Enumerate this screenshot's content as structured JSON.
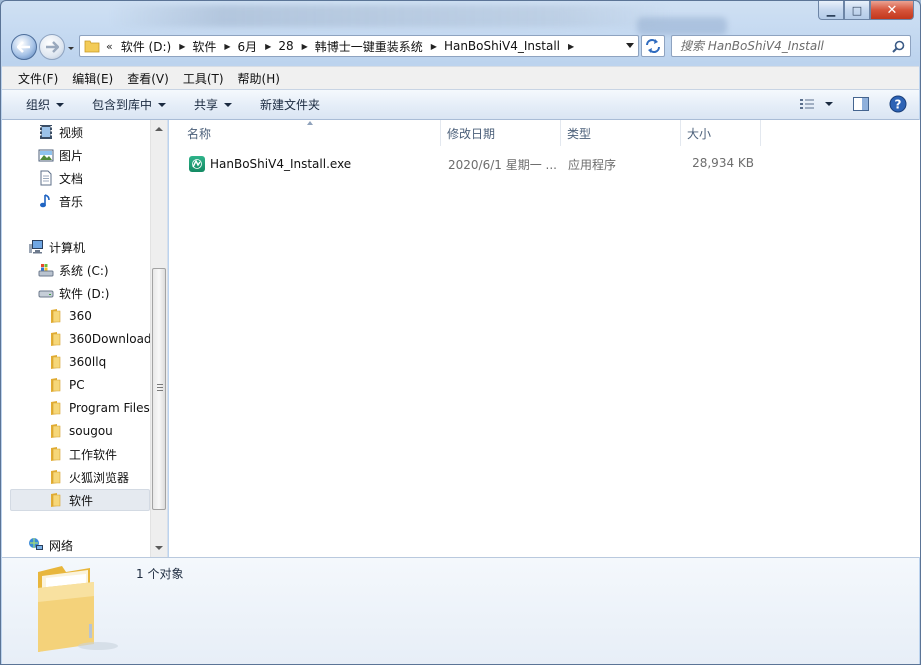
{
  "window": {
    "controls": {
      "minimize": "▁",
      "maximize": "□",
      "close": "✕"
    }
  },
  "address": {
    "overflow": "«",
    "segments": [
      "软件 (D:)",
      "软件",
      "6月",
      "28",
      "韩博士一键重装系统",
      "HanBoShiV4_Install"
    ]
  },
  "search": {
    "placeholder": "搜索 HanBoShiV4_Install"
  },
  "menu": [
    "文件(F)",
    "编辑(E)",
    "查看(V)",
    "工具(T)",
    "帮助(H)"
  ],
  "commands": [
    {
      "label": "组织",
      "dropdown": true
    },
    {
      "label": "包含到库中",
      "dropdown": true
    },
    {
      "label": "共享",
      "dropdown": true
    },
    {
      "label": "新建文件夹",
      "dropdown": false
    }
  ],
  "nav": {
    "libraries": [
      {
        "label": "视频",
        "icon": "video-library-icon"
      },
      {
        "label": "图片",
        "icon": "pictures-library-icon"
      },
      {
        "label": "文档",
        "icon": "documents-library-icon"
      },
      {
        "label": "音乐",
        "icon": "music-library-icon"
      }
    ],
    "computer": "计算机",
    "drives": [
      {
        "label": "系统 (C:)",
        "icon": "system-drive-icon"
      },
      {
        "label": "软件 (D:)",
        "icon": "drive-icon"
      }
    ],
    "folders": [
      "360",
      "360Download",
      "360llq",
      "PC",
      "Program Files",
      "sougou",
      "工作软件",
      "火狐浏览器",
      "软件"
    ],
    "selected_folder": "软件",
    "network": "网络"
  },
  "columns": [
    "名称",
    "修改日期",
    "类型",
    "大小"
  ],
  "files": [
    {
      "name": "HanBoShiV4_Install.exe",
      "date": "2020/6/1 星期一 ...",
      "type": "应用程序",
      "size": "28,934 KB",
      "icon": "installer-app-icon"
    }
  ],
  "details": {
    "count_text": "1 个对象"
  }
}
